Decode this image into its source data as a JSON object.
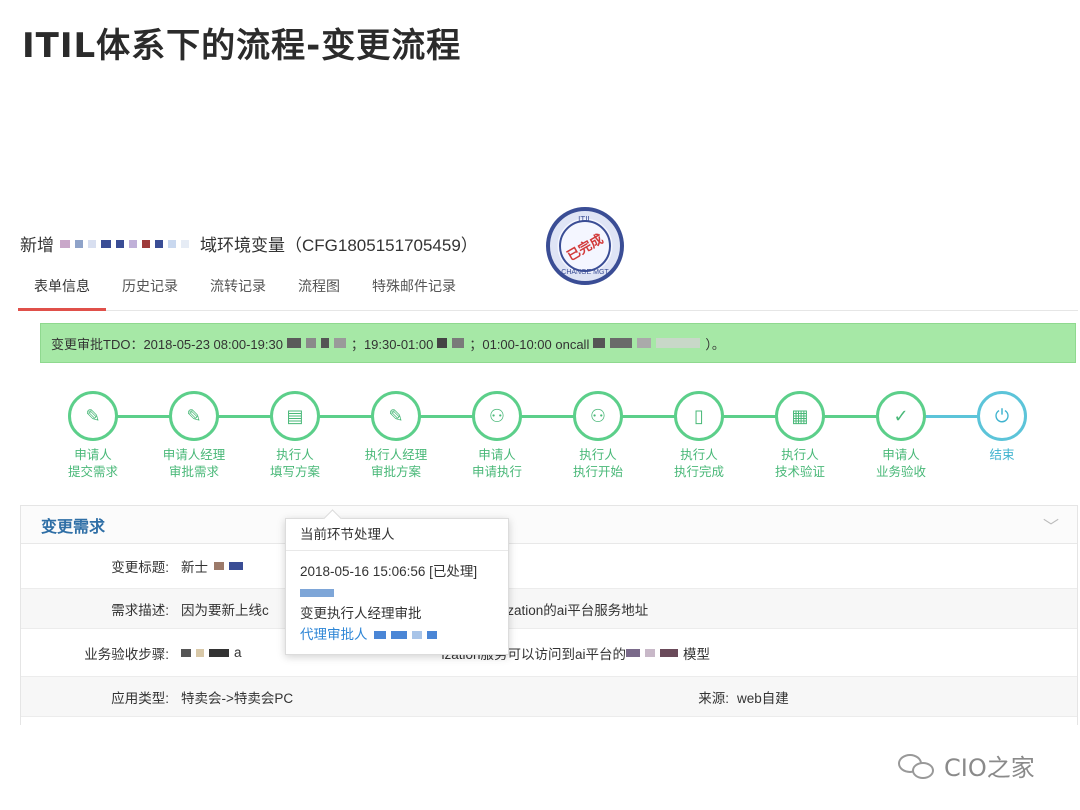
{
  "slide": {
    "title": "ITIL体系下的流程-变更流程"
  },
  "ticket": {
    "title_prefix": "新增",
    "title_suffix": "域环境变量（CFG1805151705459）",
    "stamp": {
      "center": "已完成",
      "ring_top": "ITIL",
      "ring_bottom": "CHANGE MGT"
    }
  },
  "tabs": [
    "表单信息",
    "历史记录",
    "流转记录",
    "流程图",
    "特殊邮件记录"
  ],
  "notice": {
    "part1": "变更审批TDO：2018-05-23 08:00-19:30",
    "part2": "；19:30-01:00",
    "part3": "；01:00-10:00 oncall",
    "part4": "）。"
  },
  "flow": [
    {
      "line1": "申请人",
      "line2": "提交需求",
      "icon": "edit-icon",
      "glyph": "✎"
    },
    {
      "line1": "申请人经理",
      "line2": "审批需求",
      "icon": "edit-icon",
      "glyph": "✎"
    },
    {
      "line1": "执行人",
      "line2": "填写方案",
      "icon": "notebook-icon",
      "glyph": "▤"
    },
    {
      "line1": "执行人经理",
      "line2": "审批方案",
      "icon": "edit-icon",
      "glyph": "✎"
    },
    {
      "line1": "申请人",
      "line2": "申请执行",
      "icon": "user-add-icon",
      "glyph": "⚇"
    },
    {
      "line1": "执行人",
      "line2": "执行开始",
      "icon": "user-icon",
      "glyph": "⚇"
    },
    {
      "line1": "执行人",
      "line2": "执行完成",
      "icon": "mobile-icon",
      "glyph": "▯"
    },
    {
      "line1": "执行人",
      "line2": "技术验证",
      "icon": "film-icon",
      "glyph": "▦"
    },
    {
      "line1": "申请人",
      "line2": "业务验收",
      "icon": "check-circle-icon",
      "glyph": "✓"
    },
    {
      "line1": "结束",
      "line2": "",
      "icon": "power-icon",
      "glyph": "⏻"
    }
  ],
  "panel": {
    "title": "变更需求",
    "rows": [
      {
        "label": "变更标题:",
        "value": "新士"
      },
      {
        "label": "需求描述:",
        "value_a": "因为要新上线c",
        "value_b": "量指定categorization的ai平台服务地址"
      },
      {
        "label": "业务验收步骤:",
        "value_a": "a",
        "value_b": "ization服务可以访问到ai平台的",
        "value_c": "模型"
      },
      {
        "label": "应用类型:",
        "value": "特卖会->特卖会PC",
        "label2": "来源:",
        "value2": "web自建"
      }
    ]
  },
  "popover": {
    "title": "当前环节处理人",
    "time": "2018-05-16 15:06:56 [已处理]",
    "role": "变更执行人经理审批",
    "link": "代理审批人"
  },
  "watermark": {
    "text": "CIO之家"
  }
}
